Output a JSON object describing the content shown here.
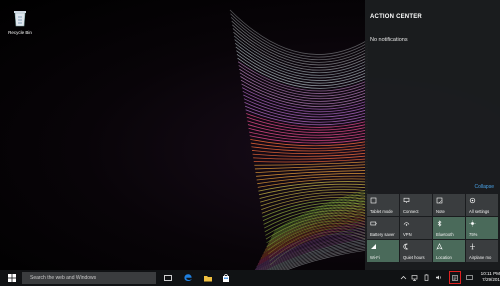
{
  "desktop": {
    "recycle_bin_label": "Recycle Bin"
  },
  "action_center": {
    "title": "ACTION CENTER",
    "empty_message": "No notifications",
    "collapse_label": "Collapse",
    "tiles": [
      {
        "label": "Tablet mode",
        "icon": "tablet-icon",
        "on": false
      },
      {
        "label": "Connect",
        "icon": "connect-icon",
        "on": false
      },
      {
        "label": "Note",
        "icon": "note-icon",
        "on": false
      },
      {
        "label": "All settings",
        "icon": "gear-icon",
        "on": false
      },
      {
        "label": "Battery saver",
        "icon": "battery-icon",
        "on": false
      },
      {
        "label": "VPN",
        "icon": "vpn-icon",
        "on": false
      },
      {
        "label": "Bluetooth",
        "icon": "bluetooth-icon",
        "on": true
      },
      {
        "label": "75%",
        "icon": "brightness-icon",
        "on": true
      },
      {
        "label": "Wi-Fi",
        "icon": "wifi-icon",
        "on": true
      },
      {
        "label": "Quiet hours",
        "icon": "moon-icon",
        "on": false
      },
      {
        "label": "Location",
        "icon": "location-icon",
        "on": true
      },
      {
        "label": "Airplane mo",
        "icon": "airplane-icon",
        "on": false
      }
    ]
  },
  "taskbar": {
    "search_placeholder": "Search the web and Windows",
    "clock_time": "10:11 PM",
    "clock_date": "7/29/201"
  },
  "colors": {
    "accent": "#4aa3e8",
    "tile_on": "#4a6a5a",
    "tile_off": "#3a3d3f",
    "highlight_box": "#e02020"
  }
}
